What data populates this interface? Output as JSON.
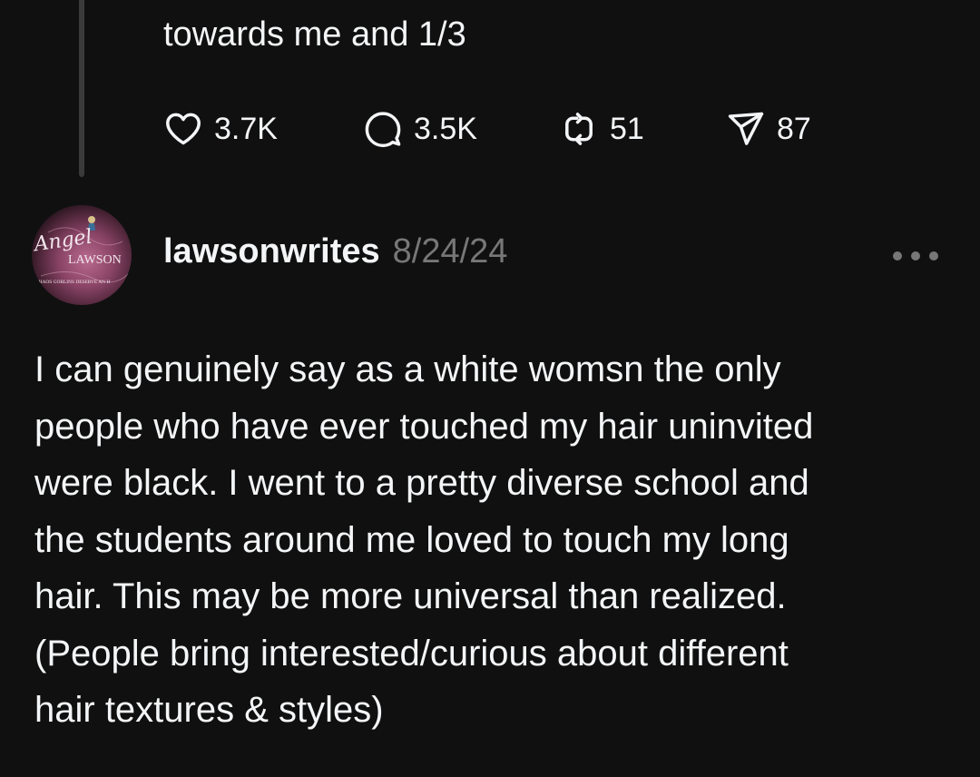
{
  "previous_post": {
    "text_tail": "towards me and 1/3",
    "stats": {
      "likes": "3.7K",
      "replies": "3.5K",
      "reposts": "51",
      "shares": "87"
    }
  },
  "post": {
    "username": "lawsonwrites",
    "date": "8/24/24",
    "avatar": {
      "script_name": "Angel",
      "name": "LAWSON",
      "tagline": "CHAOS GOBLINS DESERVE AN H"
    },
    "body_lines": [
      "I can genuinely say as a white womsn the only",
      "people who have ever touched my hair uninvited",
      "were black. I went to a pretty diverse school and",
      "the students around me loved to touch my long",
      "hair. This may be more universal than realized.",
      "(People bring interested/curious about different",
      "hair textures & styles)"
    ]
  },
  "icons": [
    "heart-icon",
    "speech-bubble-icon",
    "repost-icon",
    "send-icon",
    "more-options-icon"
  ],
  "colors": {
    "background": "#101010",
    "text": "#f3f5f7",
    "muted": "#777777",
    "thread_line": "#3a3a3a"
  }
}
